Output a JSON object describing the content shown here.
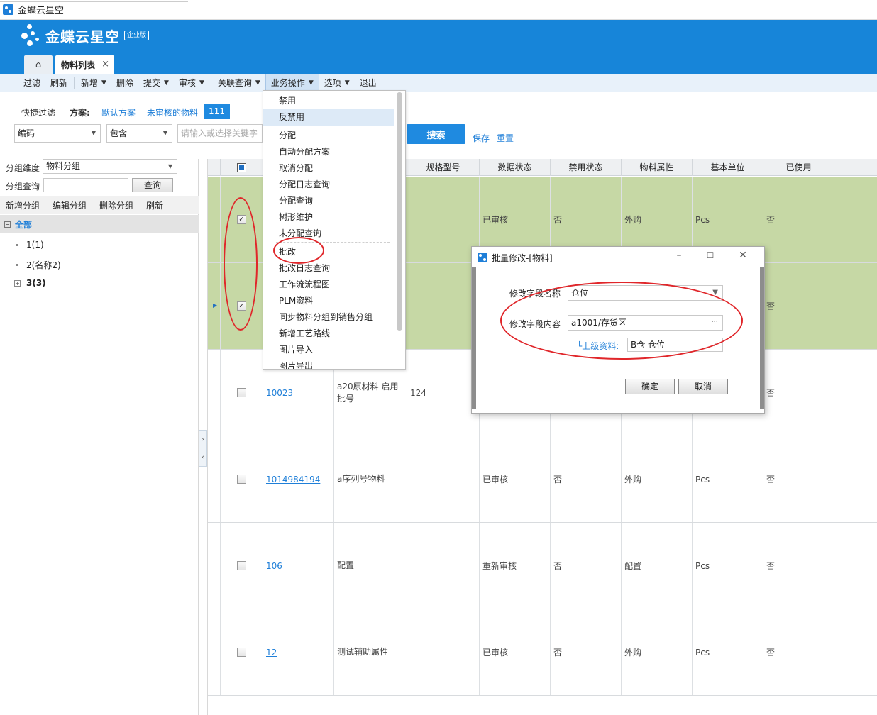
{
  "window": {
    "title": "金蝶云星空"
  },
  "header": {
    "brand": "金蝶云星空",
    "edition_badge": "企业版",
    "home_icon": "home-icon",
    "active_tab": "物料列表",
    "tab_close": "×"
  },
  "toolbar": {
    "items": [
      {
        "label": "过滤",
        "caret": false
      },
      {
        "label": "刷新",
        "caret": false
      },
      {
        "label": "新增",
        "caret": true
      },
      {
        "label": "删除",
        "caret": false
      },
      {
        "label": "提交",
        "caret": true
      },
      {
        "label": "审核",
        "caret": true
      },
      {
        "label": "关联查询",
        "caret": true
      },
      {
        "label": "业务操作",
        "caret": true,
        "active": true
      },
      {
        "label": "选项",
        "caret": true
      },
      {
        "label": "退出",
        "caret": false
      }
    ]
  },
  "quick_filter": {
    "label": "快捷过滤",
    "scheme_label": "方案:",
    "scheme_default": "默认方案",
    "scheme_unaudited": "未审核的物料",
    "scheme_111": "111",
    "field_select": "编码",
    "operator_select": "包含",
    "keyword_placeholder": "请输入或选择关键字",
    "search_button": "搜索",
    "save_link": "保存",
    "reset_link": "重置"
  },
  "left_panel": {
    "group_dim_label": "分组维度",
    "group_dim_value": "物料分组",
    "group_query_label": "分组查询",
    "query_button": "查询",
    "actions": [
      "新增分组",
      "编辑分组",
      "删除分组",
      "刷新"
    ],
    "tree_root": "全部",
    "tree_items": [
      "1(1)",
      "2(名称2)",
      "3(3)"
    ]
  },
  "grid": {
    "columns": [
      "规格型号",
      "数据状态",
      "禁用状态",
      "物料属性",
      "基本单位",
      "已使用"
    ],
    "rows": [
      {
        "selected": true,
        "code": "",
        "name": "",
        "spec": "",
        "status": "已审核",
        "disabled": "否",
        "attr": "外购",
        "unit": "Pcs",
        "used": "否"
      },
      {
        "selected": true,
        "code": "",
        "name": "",
        "spec": "",
        "status": "",
        "disabled": "",
        "attr": "",
        "unit": "",
        "used": "否"
      },
      {
        "selected": false,
        "code": "10023",
        "name": "a20原材料  启用批号",
        "spec": "124",
        "status": "",
        "disabled": "",
        "attr": "",
        "unit": "",
        "used": "否"
      },
      {
        "selected": false,
        "code": "1014984194",
        "name": "a序列号物料",
        "spec": "",
        "status": "已审核",
        "disabled": "否",
        "attr": "外购",
        "unit": "Pcs",
        "used": "否"
      },
      {
        "selected": false,
        "code": "106",
        "name": "配置",
        "spec": "",
        "status": "重新审核",
        "disabled": "否",
        "attr": "配置",
        "unit": "Pcs",
        "used": "否"
      },
      {
        "selected": false,
        "code": "12",
        "name": "测试辅助属性",
        "spec": "",
        "status": "已审核",
        "disabled": "否",
        "attr": "外购",
        "unit": "Pcs",
        "used": "否"
      }
    ]
  },
  "menu": {
    "items": [
      "禁用",
      "反禁用",
      "分配",
      "自动分配方案",
      "取消分配",
      "分配日志查询",
      "分配查询",
      "树形维护",
      "未分配查询",
      "批改",
      "批改日志查询",
      "工作流流程图",
      "PLM资料",
      "同步物料分组到销售分组",
      "新增工艺路线",
      "图片导入",
      "图片导出"
    ],
    "hover_index": 1
  },
  "dialog": {
    "title": "批量修改-[物料]",
    "field_name_label": "修改字段名称",
    "field_name_value": "仓位",
    "field_content_label": "修改字段内容",
    "field_content_value": "a1001/存货区",
    "parent_link": "上级资料:",
    "parent_value": "B仓 仓位",
    "ok_button": "确定",
    "cancel_button": "取消"
  },
  "colors": {
    "brand_blue": "#1785d9",
    "selected_row": "#c6d8a5",
    "annotation_red": "#e0262a"
  }
}
